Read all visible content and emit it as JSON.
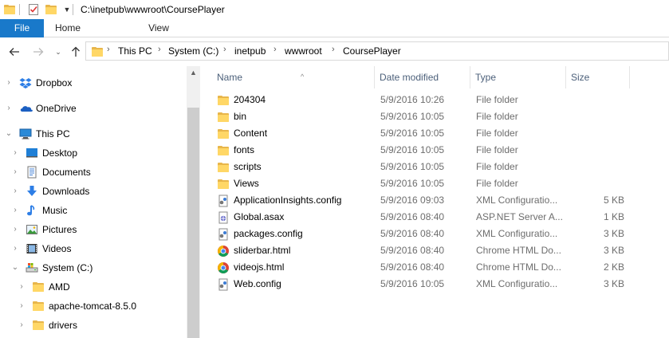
{
  "window": {
    "title_path": "C:\\inetpub\\wwwroot\\CoursePlayer"
  },
  "ribbon": {
    "tabs": [
      {
        "label": "File"
      },
      {
        "label": "Home"
      },
      {
        "label": "View"
      }
    ]
  },
  "address": {
    "crumbs": [
      "This PC",
      "System (C:)",
      "inetpub",
      "wwwroot",
      "CoursePlayer"
    ]
  },
  "nav": {
    "items": [
      {
        "label": "Dropbox",
        "icon": "dropbox-icon"
      },
      {
        "label": "OneDrive",
        "icon": "onedrive-icon"
      },
      {
        "label": "This PC",
        "icon": "this-pc-icon"
      },
      {
        "label": "Desktop",
        "icon": "desktop-icon"
      },
      {
        "label": "Documents",
        "icon": "documents-icon"
      },
      {
        "label": "Downloads",
        "icon": "downloads-icon"
      },
      {
        "label": "Music",
        "icon": "music-icon"
      },
      {
        "label": "Pictures",
        "icon": "pictures-icon"
      },
      {
        "label": "Videos",
        "icon": "videos-icon"
      },
      {
        "label": "System (C:)",
        "icon": "drive-icon"
      },
      {
        "label": "AMD",
        "icon": "folder-icon"
      },
      {
        "label": "apache-tomcat-8.5.0",
        "icon": "folder-icon"
      },
      {
        "label": "drivers",
        "icon": "folder-icon"
      }
    ]
  },
  "columns": {
    "name": "Name",
    "date": "Date modified",
    "type": "Type",
    "size": "Size"
  },
  "files": [
    {
      "name": "204304",
      "date": "5/9/2016 10:26",
      "type": "File folder",
      "size": "",
      "icon": "folder-icon"
    },
    {
      "name": "bin",
      "date": "5/9/2016 10:05",
      "type": "File folder",
      "size": "",
      "icon": "folder-icon"
    },
    {
      "name": "Content",
      "date": "5/9/2016 10:05",
      "type": "File folder",
      "size": "",
      "icon": "folder-icon"
    },
    {
      "name": "fonts",
      "date": "5/9/2016 10:05",
      "type": "File folder",
      "size": "",
      "icon": "folder-icon"
    },
    {
      "name": "scripts",
      "date": "5/9/2016 10:05",
      "type": "File folder",
      "size": "",
      "icon": "folder-icon"
    },
    {
      "name": "Views",
      "date": "5/9/2016 10:05",
      "type": "File folder",
      "size": "",
      "icon": "folder-icon"
    },
    {
      "name": "ApplicationInsights.config",
      "date": "5/9/2016 09:03",
      "type": "XML Configuratio...",
      "size": "5 KB",
      "icon": "config-file-icon"
    },
    {
      "name": "Global.asax",
      "date": "5/9/2016 08:40",
      "type": "ASP.NET Server A...",
      "size": "1 KB",
      "icon": "asax-file-icon"
    },
    {
      "name": "packages.config",
      "date": "5/9/2016 08:40",
      "type": "XML Configuratio...",
      "size": "3 KB",
      "icon": "config-file-icon"
    },
    {
      "name": "sliderbar.html",
      "date": "5/9/2016 08:40",
      "type": "Chrome HTML Do...",
      "size": "3 KB",
      "icon": "chrome-html-icon"
    },
    {
      "name": "videojs.html",
      "date": "5/9/2016 08:40",
      "type": "Chrome HTML Do...",
      "size": "2 KB",
      "icon": "chrome-html-icon"
    },
    {
      "name": "Web.config",
      "date": "5/9/2016 10:05",
      "type": "XML Configuratio...",
      "size": "3 KB",
      "icon": "config-file-icon"
    }
  ],
  "colors": {
    "file_tab": "#1979ca",
    "folder_yellow": "#ffd766",
    "header_text": "#4c607a"
  }
}
